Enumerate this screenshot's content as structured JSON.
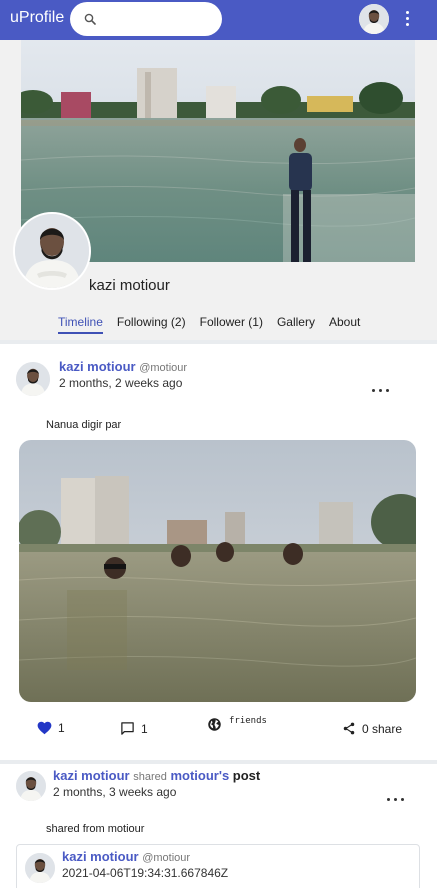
{
  "app": {
    "brand": "uProfile"
  },
  "search": {
    "placeholder": "",
    "value": ""
  },
  "profile": {
    "name": "kazi motiour",
    "tabs": [
      "Timeline",
      "Following (2)",
      "Follower (1)",
      "Gallery",
      "About"
    ],
    "active_tab": "Timeline"
  },
  "posts": [
    {
      "author": "kazi motiour",
      "handle": "@motiour",
      "time": "2 months, 2 weeks ago",
      "text": "Nanua digir par",
      "likes": "1",
      "comments": "1",
      "privacy": "friends",
      "shares": "0 share"
    },
    {
      "author": "kazi motiour",
      "shared_word": "shared",
      "shared_owner": "motiour's",
      "shared_suffix": "post",
      "time": "2 months, 3 weeks ago",
      "text": "shared from motiour",
      "original": {
        "author": "kazi motiour",
        "handle": "@motiour",
        "time": "2021-04-06T19:34:31.667846Z"
      }
    }
  ],
  "colors": {
    "accent": "#4a5ac4",
    "like": "#2337c6",
    "tab_active": "#3f51b5"
  },
  "icons": {
    "search": "search-icon",
    "menu": "more-vert-icon",
    "like": "heart-icon",
    "comment": "comment-icon",
    "privacy": "globe-icon",
    "share": "share-icon"
  }
}
